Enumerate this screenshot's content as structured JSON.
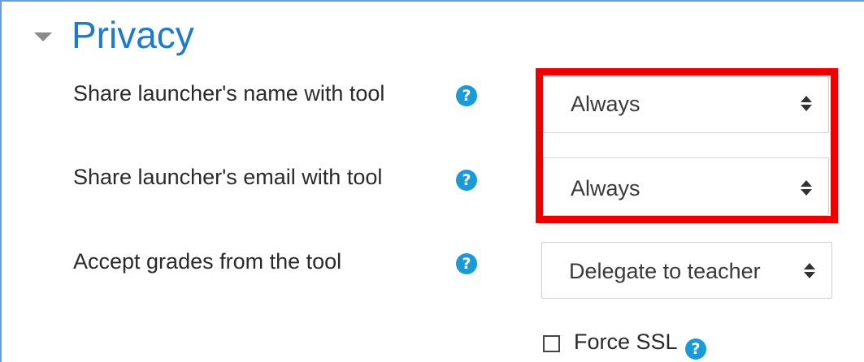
{
  "section": {
    "title": "Privacy"
  },
  "fields": [
    {
      "label": "Share launcher's name with tool",
      "help": "?",
      "value": "Always"
    },
    {
      "label": "Share launcher's email with tool",
      "help": "?",
      "value": "Always"
    },
    {
      "label": "Accept grades from the tool",
      "help": "?",
      "value": "Delegate to teacher"
    }
  ],
  "force_ssl": {
    "label": "Force SSL",
    "checked": false,
    "help": "?"
  },
  "colors": {
    "title": "#1f7ac9",
    "help_icon": "#1a9ad6",
    "highlight": "#ef0000",
    "frame_border": "#6a9fd6"
  },
  "icons": {
    "section_toggle": "caret-down-icon",
    "help": "question-circle-icon",
    "select": "sort-arrows-icon"
  }
}
